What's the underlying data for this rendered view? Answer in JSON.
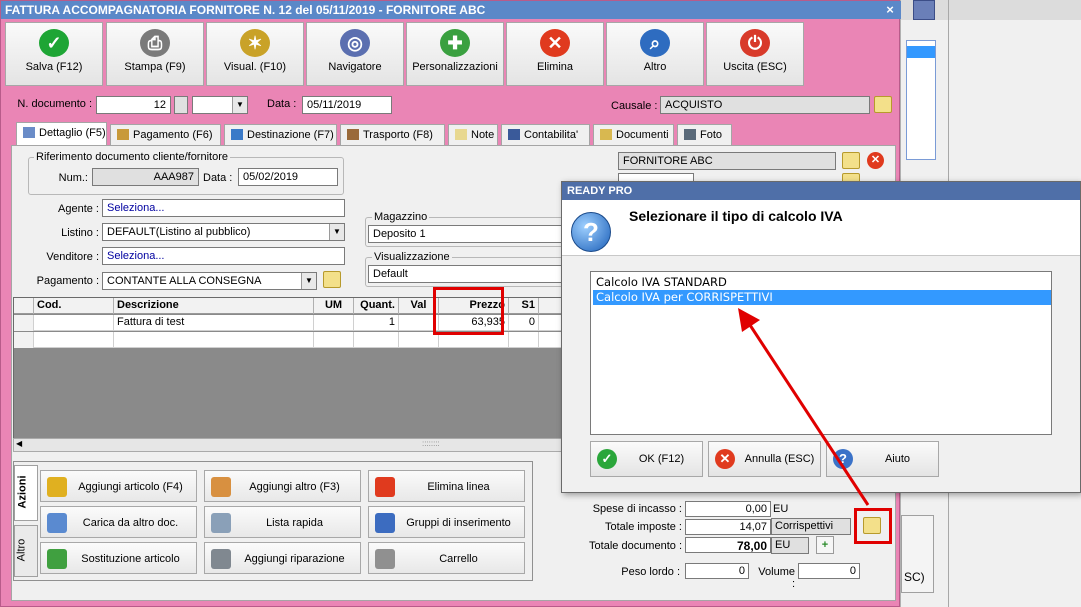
{
  "window": {
    "title": "FATTURA ACCOMPAGNATORIA FORNITORE N. 12 del 05/11/2019 - FORNITORE ABC",
    "close": "×"
  },
  "toolbar": [
    {
      "label": "Salva (F12)",
      "icon": "check-icon",
      "color": "#1ea535",
      "glyph": "✓"
    },
    {
      "label": "Stampa (F9)",
      "icon": "printer-icon",
      "color": "#7a7a7a",
      "glyph": "⎙"
    },
    {
      "label": "Visual. (F10)",
      "icon": "magic-wand-icon",
      "color": "#c9a228",
      "glyph": "✶"
    },
    {
      "label": "Navigatore",
      "icon": "compass-icon",
      "color": "#5b6fb0",
      "glyph": "◎"
    },
    {
      "label": "Personalizzazioni",
      "icon": "puzzle-icon",
      "color": "#3aa040",
      "glyph": "✚"
    },
    {
      "label": "Elimina",
      "icon": "delete-x-icon",
      "color": "#e03a1e",
      "glyph": "✕"
    },
    {
      "label": "Altro",
      "icon": "book-search-icon",
      "color": "#2e6cc0",
      "glyph": "⌕"
    },
    {
      "label": "Uscita (ESC)",
      "icon": "power-icon",
      "color": "#d83a2a",
      "glyph": "⏻"
    }
  ],
  "header": {
    "num_doc_label": "N. documento :",
    "num_doc_value": "12",
    "data_label": "Data :",
    "data_value": "05/11/2019",
    "causale_label": "Causale :",
    "causale_value": "ACQUISTO"
  },
  "tabs": [
    "Dettaglio (F5)",
    "Pagamento (F6)",
    "Destinazione (F7)",
    "Trasporto (F8)",
    "Note",
    "Contabilita'",
    "Documenti",
    "Foto"
  ],
  "riferimento": {
    "title": "Riferimento documento cliente/fornitore",
    "num_label": "Num.:",
    "num_value": "AAA987",
    "data_label": "Data :",
    "data_value": "05/02/2019"
  },
  "form": {
    "agente_label": "Agente :",
    "agente_value": "Seleziona...",
    "listino_label": "Listino :",
    "listino_value": "DEFAULT(Listino al pubblico)",
    "venditore_label": "Venditore :",
    "venditore_value": "Seleziona...",
    "pagamento_label": "Pagamento :",
    "pagamento_value": "CONTANTE ALLA CONSEGNA",
    "magazzino_label": "Magazzino",
    "magazzino_value": "Deposito 1",
    "visualizzazione_label": "Visualizzazione",
    "visualizzazione_value": "Default",
    "fornitore_value": "FORNITORE ABC"
  },
  "grid": {
    "columns": [
      "Cod.",
      "Descrizione",
      "UM",
      "Quant.",
      "Val",
      "Prezzo",
      "S1"
    ],
    "rows": [
      {
        "cod": "",
        "descrizione": "Fattura di test",
        "um": "",
        "quant": "1",
        "val": "",
        "prezzo": "63,935",
        "s1": "0"
      }
    ],
    "scroll_grip": "::::::::"
  },
  "actions": {
    "tab_azioni": "Azioni",
    "tab_altro": "Altro",
    "buttons": [
      {
        "label": "Aggiungi articolo (F4)",
        "icon": "add-box-icon",
        "color": "#e0b020"
      },
      {
        "label": "Aggiungi altro (F3)",
        "icon": "add-grid-icon",
        "color": "#d89040"
      },
      {
        "label": "Elimina linea",
        "icon": "delete-x-icon",
        "color": "#e03a1e"
      },
      {
        "label": "Carica da altro doc.",
        "icon": "doc-load-icon",
        "color": "#5a8ad0"
      },
      {
        "label": "Lista rapida",
        "icon": "quick-list-icon",
        "color": "#8aa0b8"
      },
      {
        "label": "Gruppi di inserimento",
        "icon": "group-insert-icon",
        "color": "#3c6cc0"
      },
      {
        "label": "Sostituzione articolo",
        "icon": "replace-icon",
        "color": "#40a040"
      },
      {
        "label": "Aggiungi riparazione",
        "icon": "wrench-icon",
        "color": "#808890"
      },
      {
        "label": "Carrello",
        "icon": "cart-icon",
        "color": "#909090"
      }
    ]
  },
  "totals": {
    "spese_label": "Spese di incasso :",
    "spese_value": "0,00",
    "spese_unit": "EU",
    "imposte_label": "Totale imposte :",
    "imposte_value": "14,07",
    "imposte_mode": "Corrispettivi",
    "documento_label": "Totale documento :",
    "documento_value": "78,00",
    "documento_unit": "EU",
    "peso_label": "Peso lordo :",
    "peso_value": "0",
    "volume_label": "Volume :",
    "volume_value": "0"
  },
  "dialog": {
    "title": "READY PRO",
    "message": "Selezionare il tipo di calcolo IVA",
    "options": [
      "Calcolo IVA STANDARD",
      "Calcolo IVA per CORRISPETTIVI"
    ],
    "selected_index": 1,
    "ok_label": "OK (F12)",
    "annulla_label": "Annulla (ESC)",
    "aiuto_label": "Aiuto"
  },
  "background_app": {
    "esc_label": "SC)"
  },
  "colors": {
    "window_bg": "#ea85b5",
    "titlebar": "#5b88c8",
    "highlight": "#e00000",
    "selection": "#3399ff"
  }
}
